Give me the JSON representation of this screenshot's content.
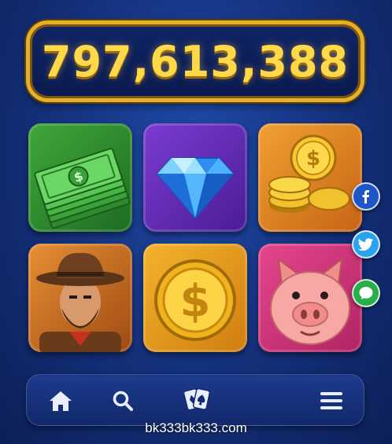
{
  "jackpot": {
    "value": "797,613,388"
  },
  "tiles": [
    {
      "icon": "cash-stack-icon",
      "color": "#3fa73a"
    },
    {
      "icon": "diamond-icon",
      "color": "#7b3cd1"
    },
    {
      "icon": "gold-coins-icon",
      "color": "#f0a033"
    },
    {
      "icon": "cowboy-icon",
      "color": "#e58f34"
    },
    {
      "icon": "dollar-coin-icon",
      "color": "#f3b42c"
    },
    {
      "icon": "pig-icon",
      "color": "#e6468e"
    }
  ],
  "social": [
    "facebook-icon",
    "twitter-icon",
    "message-icon"
  ],
  "navbar": {
    "items": [
      "home-icon",
      "search-icon",
      "cards-icon",
      "menu-icon"
    ]
  },
  "footer": {
    "site_text": "bk333bk333.com"
  }
}
